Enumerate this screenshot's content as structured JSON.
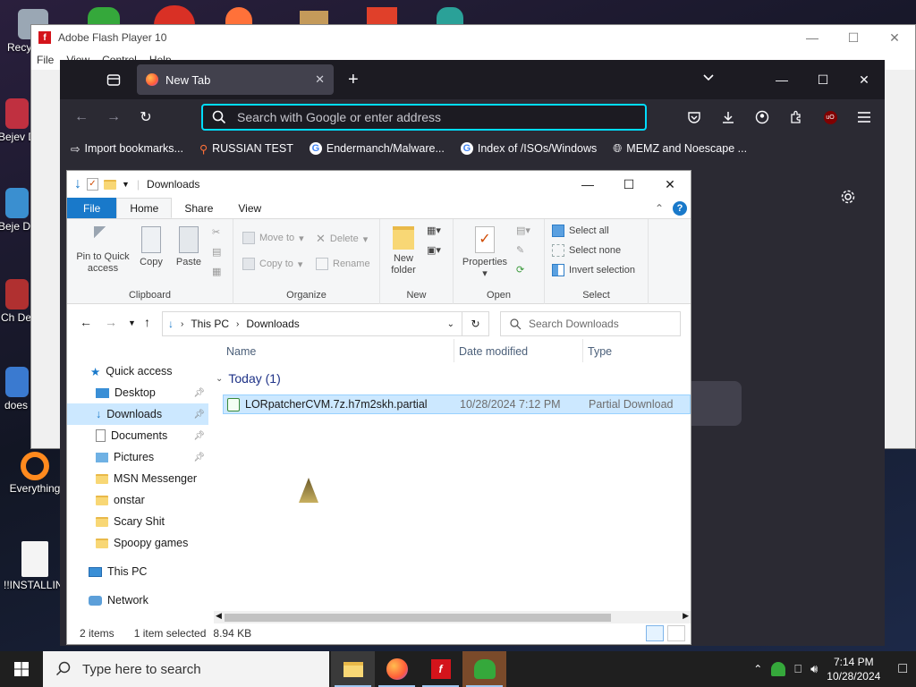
{
  "desktop": {
    "icons": [
      {
        "label": "Recy",
        "color": "#9aa7b4"
      },
      {
        "label": "Bejev De",
        "color": "#c03040"
      },
      {
        "label": "Beje De",
        "color": "#3a8fd0"
      },
      {
        "label": "Ch De",
        "color": "#b03030"
      },
      {
        "label": "does",
        "color": "#3a7ad0"
      },
      {
        "label": "Everything",
        "color": "#ff8a1e"
      },
      {
        "label": "!!INSTALLIN..",
        "color": "#f4f4f4"
      }
    ]
  },
  "flash": {
    "title": "Adobe Flash Player 10",
    "logo_letter": "f",
    "menu": [
      "File",
      "View",
      "Control",
      "Help"
    ]
  },
  "firefox": {
    "tab_title": "New Tab",
    "url_placeholder": "Search with Google or enter address",
    "bookmarks": [
      {
        "label": "Import bookmarks...",
        "icon": "import-icon"
      },
      {
        "label": "RUSSIAN TEST",
        "icon": "search-icon"
      },
      {
        "label": "Endermanch/Malware...",
        "icon": "google-icon"
      },
      {
        "label": "Index of /ISOs/Windows",
        "icon": "google-icon"
      },
      {
        "label": "MEMZ and Noescape ...",
        "icon": "globe-icon"
      }
    ],
    "accent": "#00ddff"
  },
  "explorer": {
    "title": "Downloads",
    "ribbon_tabs": {
      "file": "File",
      "home": "Home",
      "share": "Share",
      "view": "View"
    },
    "ribbon": {
      "clipboard": {
        "pin": "Pin to Quick access",
        "copy": "Copy",
        "paste": "Paste",
        "group": "Clipboard"
      },
      "organize": {
        "move_to": "Move to",
        "copy_to": "Copy to",
        "delete": "Delete",
        "rename": "Rename",
        "group": "Organize"
      },
      "new": {
        "new_folder": "New folder",
        "group": "New"
      },
      "open": {
        "properties": "Properties",
        "group": "Open"
      },
      "select": {
        "select_all": "Select all",
        "select_none": "Select none",
        "invert": "Invert selection",
        "group": "Select"
      }
    },
    "address": {
      "this_pc": "This PC",
      "downloads": "Downloads",
      "search_placeholder": "Search Downloads"
    },
    "nav": {
      "quick_access": "Quick access",
      "items": [
        {
          "label": "Desktop",
          "pinned": true,
          "icon": "desktop-icon"
        },
        {
          "label": "Downloads",
          "pinned": true,
          "icon": "download-arrow-icon"
        },
        {
          "label": "Documents",
          "pinned": true,
          "icon": "document-icon"
        },
        {
          "label": "Pictures",
          "pinned": true,
          "icon": "pictures-icon"
        },
        {
          "label": "MSN Messenger",
          "pinned": false,
          "icon": "folder-icon"
        },
        {
          "label": "onstar",
          "pinned": false,
          "icon": "folder-icon"
        },
        {
          "label": "Scary Shit",
          "pinned": false,
          "icon": "folder-icon"
        },
        {
          "label": "Spoopy games",
          "pinned": false,
          "icon": "folder-icon"
        }
      ],
      "this_pc": "This PC",
      "network": "Network"
    },
    "columns": {
      "name": "Name",
      "date": "Date modified",
      "type": "Type"
    },
    "group": "Today (1)",
    "files": [
      {
        "name": "LORpatcherCVM.7z.h7m2skh.partial",
        "date": "10/28/2024 7:12 PM",
        "type": "Partial Download"
      }
    ],
    "status": {
      "items": "2 items",
      "selected": "1 item selected",
      "size": "8.94 KB"
    },
    "ribbon_accent": "#1979ca"
  },
  "taskbar": {
    "search_placeholder": "Type here to search",
    "apps": [
      "file-explorer-icon",
      "firefox-icon",
      "flash-player-icon",
      "msn-messenger-icon"
    ],
    "time": "7:14 PM",
    "date": "10/28/2024"
  }
}
